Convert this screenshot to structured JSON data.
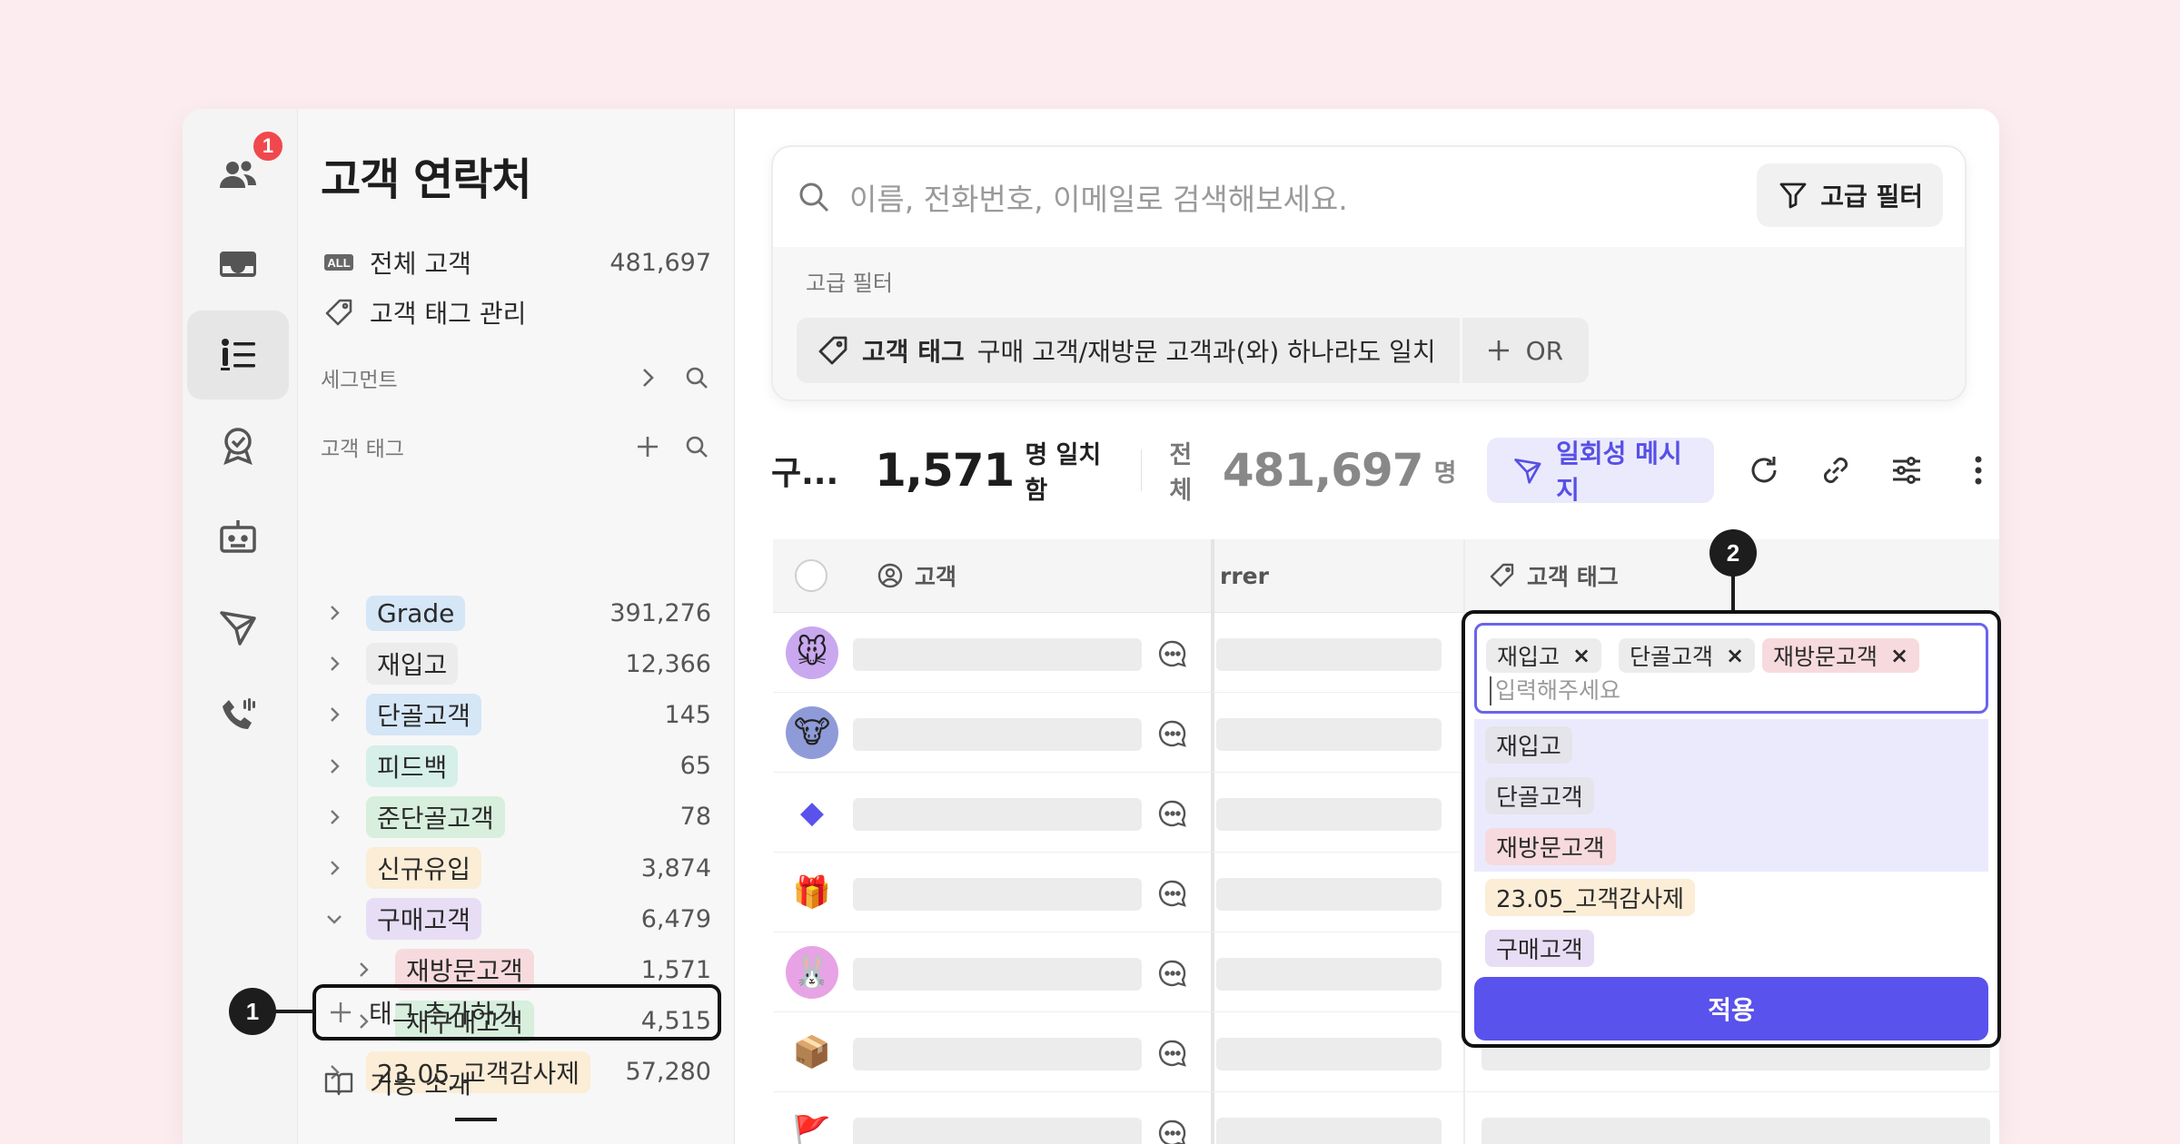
{
  "rail": {
    "badge_count": "1",
    "items": [
      {
        "icon": "users-icon"
      },
      {
        "icon": "inbox-icon"
      },
      {
        "icon": "contacts-list-icon",
        "active": true
      },
      {
        "icon": "badge-check-icon"
      },
      {
        "icon": "bot-icon"
      },
      {
        "icon": "send-icon"
      },
      {
        "icon": "phone-icon"
      }
    ]
  },
  "sidebar": {
    "title": "고객 연락처",
    "all_customers": {
      "icon_text": "ALL",
      "label": "전체 고객",
      "count": "481,697"
    },
    "tag_manage": {
      "label": "고객 태그 관리"
    },
    "segment_label": "세그먼트",
    "tags_label": "고객 태그",
    "tags": [
      {
        "label": "Grade",
        "count": "391,276",
        "color": "#d5e6f7",
        "expanded": false,
        "indent": 0
      },
      {
        "label": "재입고",
        "count": "12,366",
        "color": "#ececec",
        "expanded": false,
        "indent": 0
      },
      {
        "label": "단골고객",
        "count": "145",
        "color": "#d5e6f7",
        "expanded": false,
        "indent": 0
      },
      {
        "label": "피드백",
        "count": "65",
        "color": "#d6efe9",
        "expanded": false,
        "indent": 0
      },
      {
        "label": "준단골고객",
        "count": "78",
        "color": "#d7efdc",
        "expanded": false,
        "indent": 0
      },
      {
        "label": "신규유입",
        "count": "3,874",
        "color": "#fbedd6",
        "expanded": false,
        "indent": 0
      },
      {
        "label": "구매고객",
        "count": "6,479",
        "color": "#e7def5",
        "expanded": true,
        "indent": 0
      },
      {
        "label": "재방문고객",
        "count": "1,571",
        "color": "#f7dadd",
        "expanded": false,
        "indent": 1
      },
      {
        "label": "재구매고객",
        "count": "4,515",
        "color": "#d7efdc",
        "expanded": false,
        "indent": 1
      },
      {
        "label": "23.05_고객감사제",
        "count": "57,280",
        "color": "#fbedd6",
        "expanded": false,
        "indent": 0
      }
    ],
    "add_tag_label": "태그 추가하기",
    "feature_intro_label": "기능 소개"
  },
  "callouts": {
    "one": "1",
    "two": "2"
  },
  "search": {
    "placeholder": "이름, 전화번호, 이메일로 검색해보세요.",
    "advanced_button": "고급 필터",
    "advanced_label": "고급 필터",
    "filter_chip": {
      "bold": "고객 태그",
      "text": "구매 고객/재방문 고객과(와) 하나라도 일치"
    },
    "or_button": "OR"
  },
  "toolbar": {
    "segment_short": "구...",
    "match_count": "1,571",
    "match_unit": "명 일치함",
    "total_label": "전체",
    "total_count": "481,697",
    "total_unit": "명",
    "message_button": "일회성 메시지"
  },
  "table": {
    "col_customer": "고객",
    "col_referrer_partial": "rrer",
    "col_tags": "고객 태그",
    "rows": [
      {
        "avatar": "🐭",
        "bg": "#c9a8f0"
      },
      {
        "avatar": "🐮",
        "bg": "#8f9bd8"
      },
      {
        "avatar": "◆",
        "bg": "#ffffff"
      },
      {
        "avatar": "🎁",
        "bg": "#ffffff"
      },
      {
        "avatar": "🐰",
        "bg": "#e7a3e6"
      },
      {
        "avatar": "📦",
        "bg": "#ffffff"
      },
      {
        "avatar": "🚩",
        "bg": "#ffffff"
      }
    ]
  },
  "dropdown": {
    "selected": [
      {
        "label": "재입고",
        "color": "#ececec"
      },
      {
        "label": "단골고객",
        "color": "#ececec"
      },
      {
        "label": "재방문고객",
        "color": "#f7dadd"
      }
    ],
    "remove_symbol": "×",
    "placeholder": "입력해주세요",
    "options": [
      {
        "label": "재입고",
        "color": "#e4e4ea",
        "selected": true
      },
      {
        "label": "단골고객",
        "color": "#e4e4ea",
        "selected": true
      },
      {
        "label": "재방문고객",
        "color": "#f7dadd",
        "selected": true
      },
      {
        "label": "23.05_고객감사제",
        "color": "#fbedd6",
        "selected": false
      },
      {
        "label": "구매고객",
        "color": "#e7def5",
        "selected": false
      }
    ],
    "apply_label": "적용"
  }
}
